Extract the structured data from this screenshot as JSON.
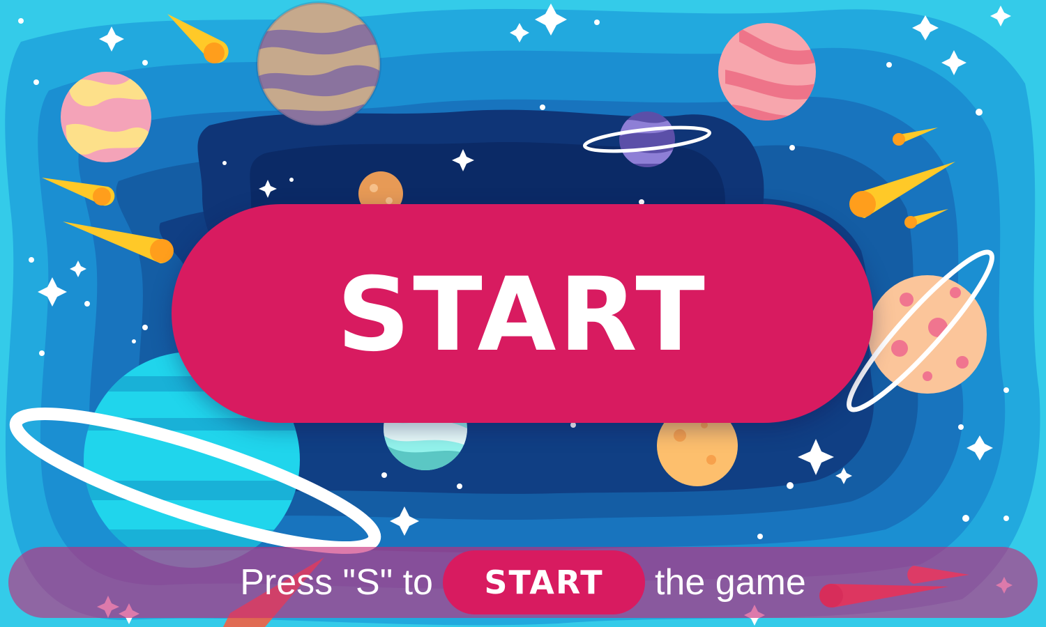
{
  "colors": {
    "bg_outer": "#2ec6e8",
    "bg_deep": "#0d2d6b",
    "button": "#d81b60",
    "bar": "rgba(200,40,120,0.62)",
    "comet": "#ffc928",
    "star": "#ffffff"
  },
  "start_button": {
    "label": "START"
  },
  "instruction": {
    "prefix": "Press \"S\" to",
    "keyword": "START",
    "suffix": "the game"
  },
  "icons": [
    "star-icon",
    "comet-icon",
    "planet-icon",
    "ringed-planet-icon"
  ]
}
